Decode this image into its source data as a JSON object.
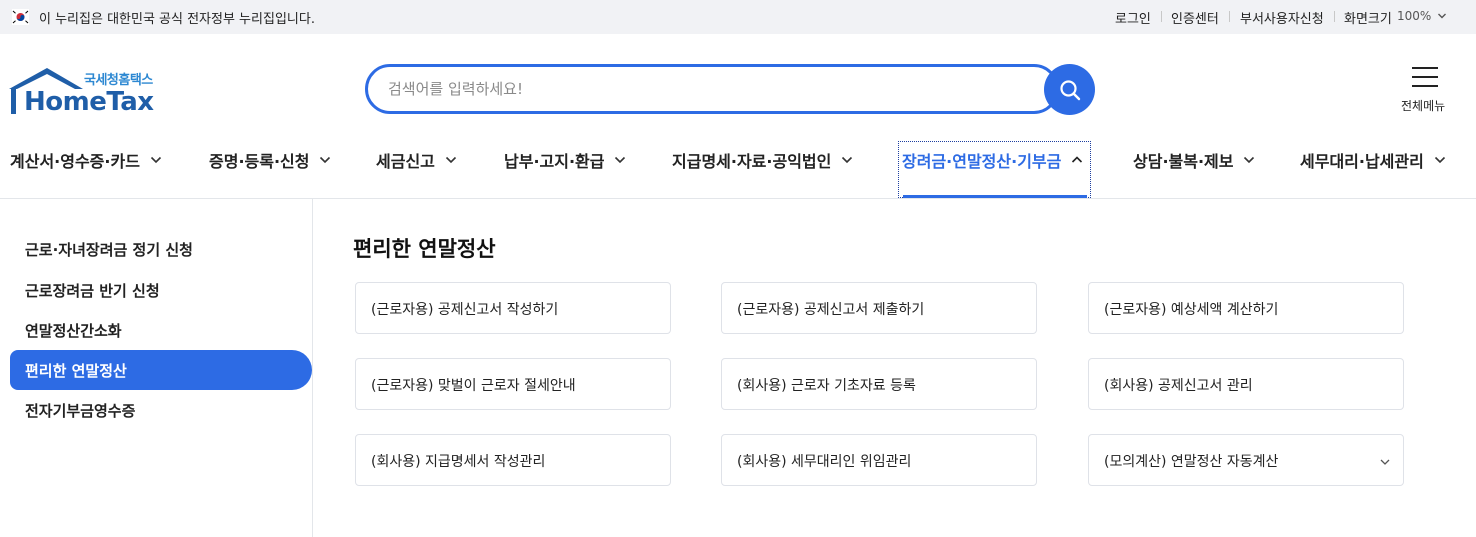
{
  "gov_bar": {
    "notice": "이 누리집은 대한민국 공식 전자정부 누리집입니다.",
    "links": [
      "로그인",
      "인증센터",
      "부서사용자신청",
      "화면크기"
    ],
    "zoom": "100%"
  },
  "header": {
    "logo_sub": "국세청홈택스",
    "logo_main": "HomeTax",
    "search_placeholder": "검색어를 입력하세요!",
    "all_menu_label": "전체메뉴"
  },
  "gnb": {
    "items": [
      "계산서·영수증·카드",
      "증명·등록·신청",
      "세금신고",
      "납부·고지·환급",
      "지급명세·자료·공익법인",
      "장려금·연말정산·기부금",
      "상담·불복·제보",
      "세무대리·납세관리"
    ],
    "active_index": 5
  },
  "sidebar": {
    "items": [
      "근로·자녀장려금 정기 신청",
      "근로장려금 반기 신청",
      "연말정산간소화",
      "편리한 연말정산",
      "전자기부금영수증"
    ],
    "active_index": 3
  },
  "main": {
    "title": "편리한 연말정산",
    "cards": [
      "(근로자용) 공제신고서 작성하기",
      "(근로자용) 공제신고서 제출하기",
      "(근로자용) 예상세액 계산하기",
      "(근로자용) 맞벌이 근로자 절세안내",
      "(회사용) 근로자 기초자료 등록",
      "(회사용) 공제신고서 관리",
      "(회사용) 지급명세서 작성관리",
      "(회사용) 세무대리인 위임관리",
      "(모의계산) 연말정산 자동계산"
    ]
  },
  "colors": {
    "accent": "#2d6be4",
    "logo_blue": "#1f5ea8",
    "topbar_bg": "#f1f2f5"
  }
}
